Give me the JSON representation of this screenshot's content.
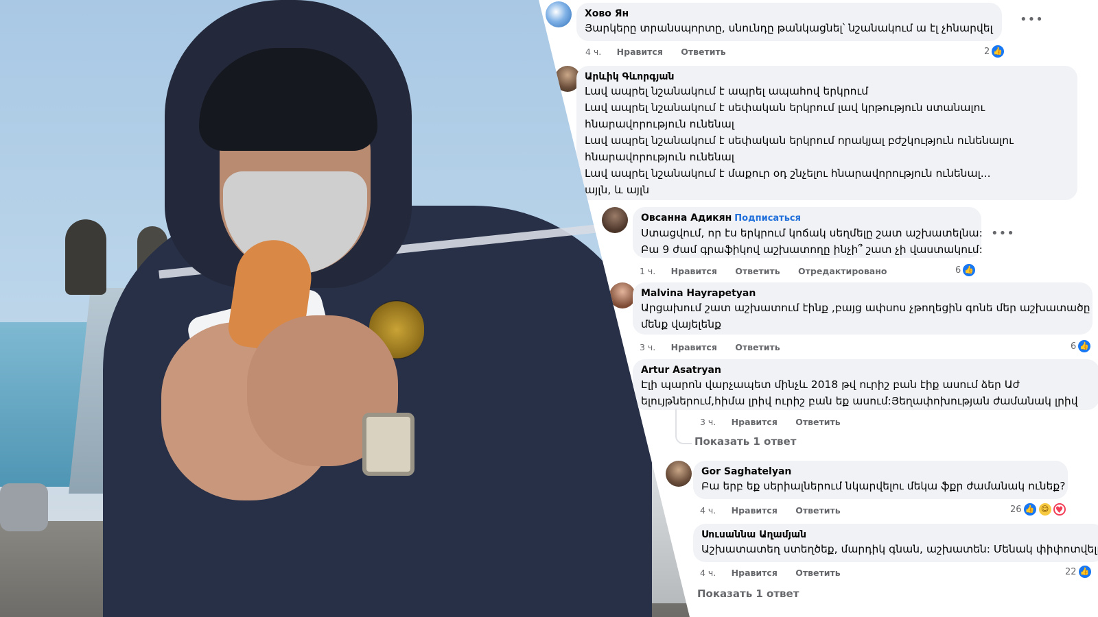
{
  "comments": [
    {
      "name": "Хово Ян",
      "lines": [
        "Յարկերը տրանսպորտը, սնունդը թանկացնել՝ նշանակում ա էլ չհնարվել"
      ],
      "time": "4 ч.",
      "like": "Нравится",
      "reply": "Ответить",
      "reactions": "2"
    },
    {
      "name": "Արևիկ Գևորգյան",
      "lines": [
        "Լավ ապրել նշանակում է ապրել ապահով երկրում",
        "Լավ ապրել նշանակում է սեփական երկրում լավ կրթություն ստանալու",
        "հնարավորություն ունենալ",
        "Լավ ապրել նշանակում է սեփական երկրում որակյալ բժշկություն ունենալու",
        "հնարավորություն ունենալ",
        "Լավ ապրել նշանակում է մաքուր օդ շնչելու հնարավորություն ունենալ...",
        "այլն, և այլն"
      ]
    },
    {
      "name": "Овсанна Адикян",
      "follow": "Подписаться",
      "lines": [
        "Ստացվում, որ էս երկրում կոճակ սեղմելը շատ աշխատելնա:",
        "Բա 9 ժամ գրաֆիկով աշխատողը ինչի՞ շատ չի վաստակում:"
      ],
      "time": "1 ч.",
      "like": "Нравится",
      "reply": "Ответить",
      "edited": "Отредактировано",
      "reactions": "6"
    },
    {
      "name": "Malvina Hayrapetyan",
      "lines": [
        "Արցախում շատ աշխատում էինք ,բայց ափսոս չթողեցին գոնե մեր աշխատածը",
        "մենք վայելենք"
      ],
      "time": "3 ч.",
      "like": "Нравится",
      "reply": "Ответить",
      "reactions": "6"
    },
    {
      "name": "Artur Asatryan",
      "lines": [
        "Էլի պարոն վարչապետ մինչև 2018 թվ ուրիշ բան էիք ասում ձեր Աժ",
        "ելույթներում,հիմա լրիվ ուրիշ բան եք ասում:Յեղափոխության ժամանակ լրիվ"
      ],
      "time": "3 ч.",
      "like": "Нравится",
      "reply": "Ответить",
      "show_replies": "Показать 1 ответ"
    },
    {
      "name": "Gor Saghatelyan",
      "lines": [
        "Բա երբ եք սերիալներում նկարվելու մեկա ֆքր ժամանակ ունեք?"
      ],
      "time": "4 ч.",
      "like": "Нравится",
      "reply": "Ответить",
      "reactions": "26"
    },
    {
      "name": "Սուսաննա Աղամյան",
      "lines": [
        "Աշխատատեղ ստեղծեք, մարդիկ գնան, աշխատեն: Մենակ փիփոտվելը"
      ],
      "time": "4 ч.",
      "like": "Нравится",
      "reply": "Ответить",
      "reactions": "22",
      "show_replies": "Показать 1 ответ"
    }
  ],
  "icons": {
    "more": "more-options-icon",
    "like": "like-reaction-icon",
    "haha": "haha-reaction-icon",
    "care": "care-reaction-icon"
  },
  "colors": {
    "bubble": "#f0f2f5",
    "link_blue": "#216fdb",
    "like_blue": "#1877f2",
    "meta_gray": "#65676b"
  }
}
